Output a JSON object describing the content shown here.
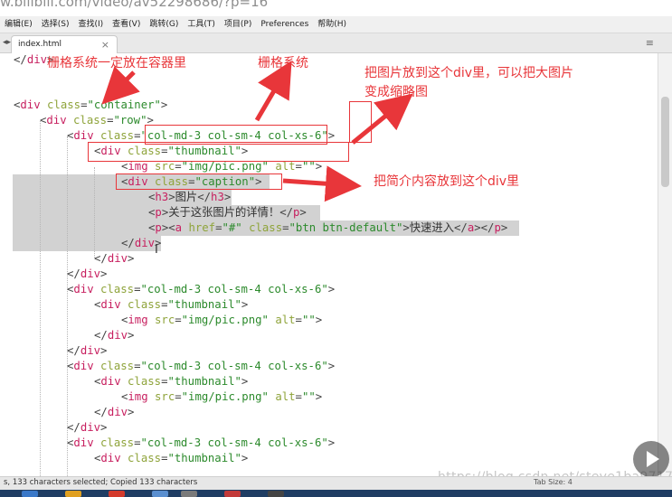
{
  "url_fragment": "w.bilibili.com/video/av52298686/?p=16",
  "menu": [
    "编辑(E)",
    "选择(S)",
    "查找(I)",
    "查看(V)",
    "跳转(G)",
    "工具(T)",
    "项目(P)",
    "Preferences",
    "帮助(H)"
  ],
  "tab": {
    "label": "index.html",
    "close": "×",
    "arrows": "◂▸",
    "menu_glyph": "≡"
  },
  "code": {
    "l0": "</div>",
    "div": "div",
    "img": "img",
    "h3": "h3",
    "p": "p",
    "a": "a",
    "class": "class",
    "src": "src",
    "alt": "alt",
    "href": "href",
    "container": "\"container\"",
    "row": "\"row\"",
    "col": "\"col-md-3 col-sm-4 col-xs-6\"",
    "thumbnail": "\"thumbnail\"",
    "caption": "\"caption\"",
    "img_src": "\"img/pic.png\"",
    "empty": "\"\"",
    "hash": "\"#\"",
    "btn": "\"btn btn-default\"",
    "h3_text": "图片",
    "p_text": "关于这张图片的详情！",
    "a_text": "快速进入"
  },
  "annotations": {
    "grid_in_container": "栅格系统一定放在容器里",
    "grid_system": "栅格系统",
    "thumbnail_note_1": "把图片放到这个div里，可以把大图片",
    "thumbnail_note_2": "变成缩略图",
    "caption_note": "把简介内容放到这个div里"
  },
  "status": {
    "left": "s, 133 characters selected; Copied 133 characters",
    "right": "Tab Size: 4"
  },
  "watermark": "https://blog.csdn.net/steve1ba9717",
  "colors": {
    "tag": "#c71f5f",
    "attr": "#8fa43b",
    "string": "#2c8a2c",
    "annotation": "#e8363a",
    "selection": "#d2d2d2"
  },
  "icons": [
    "play-icon",
    "close-icon",
    "menu-icon"
  ]
}
